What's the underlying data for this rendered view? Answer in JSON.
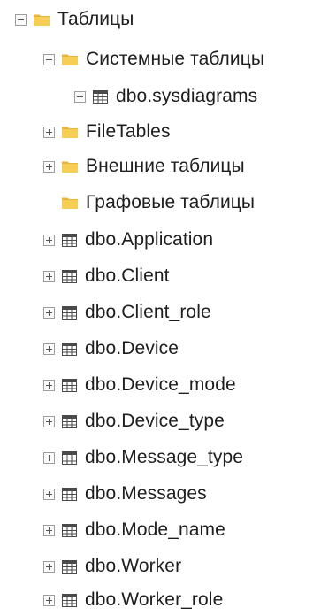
{
  "tree": {
    "root": {
      "label": "Таблицы"
    },
    "system_tables": {
      "label": "Системные таблицы"
    },
    "sysdiagrams": {
      "label": "dbo.sysdiagrams"
    },
    "filetables": {
      "label": "FileTables"
    },
    "external_tables": {
      "label": "Внешние таблицы"
    },
    "graph_tables": {
      "label": "Графовые таблицы"
    },
    "tables": [
      "dbo.Application",
      "dbo.Client",
      "dbo.Client_role",
      "dbo.Device",
      "dbo.Device_mode",
      "dbo.Device_type",
      "dbo.Message_type",
      "dbo.Messages",
      "dbo.Mode_name",
      "dbo.Worker",
      "dbo.Worker_role"
    ]
  },
  "icons": {
    "folder": "folder-icon",
    "table": "table-icon",
    "expand": "plus-box",
    "collapse": "minus-box"
  },
  "colors": {
    "folder": "#f4c542",
    "text": "#1e1e1e"
  }
}
